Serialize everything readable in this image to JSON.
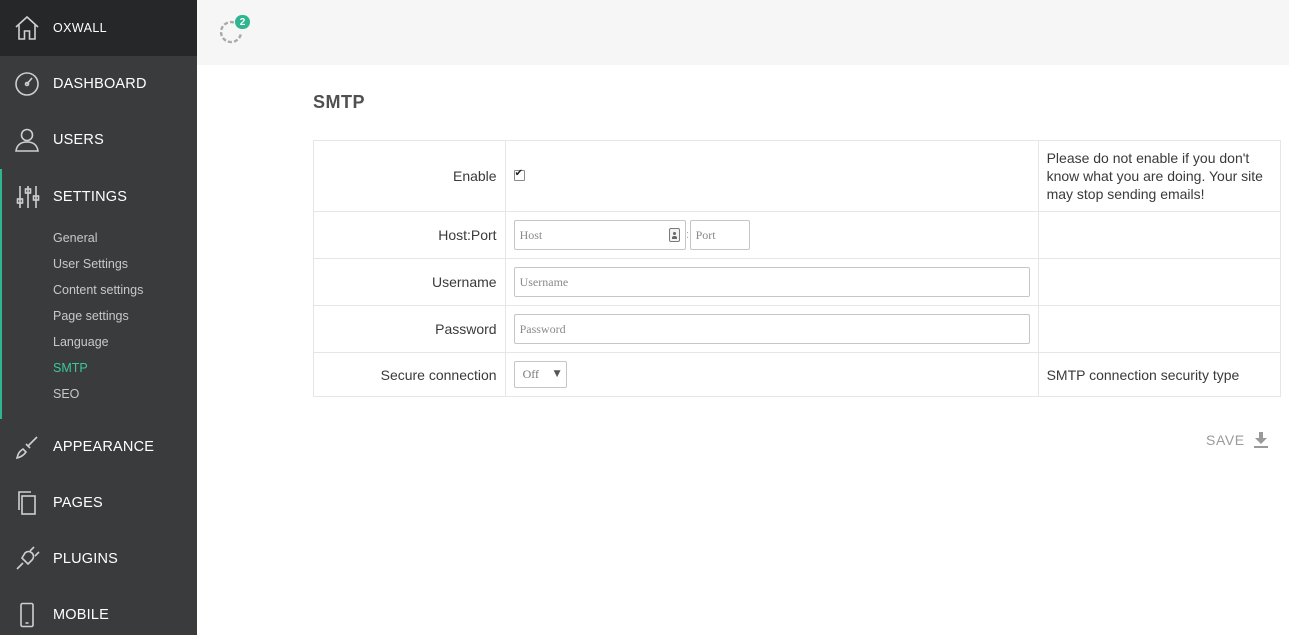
{
  "sidebar": {
    "brand": {
      "label": "OXWALL",
      "icon": "home-icon"
    },
    "items": [
      {
        "label": "DASHBOARD",
        "icon": "gauge-icon"
      },
      {
        "label": "USERS",
        "icon": "user-icon"
      },
      {
        "label": "SETTINGS",
        "icon": "sliders-icon"
      },
      {
        "label": "APPEARANCE",
        "icon": "brush-icon"
      },
      {
        "label": "PAGES",
        "icon": "pages-icon"
      },
      {
        "label": "PLUGINS",
        "icon": "plug-icon"
      },
      {
        "label": "MOBILE",
        "icon": "mobile-icon"
      }
    ],
    "settings_sub": [
      "General",
      "User Settings",
      "Content settings",
      "Page settings",
      "Language",
      "SMTP",
      "SEO"
    ],
    "active_sub": "SMTP"
  },
  "topbar": {
    "sync_badge": "2",
    "icon": "sync-icon"
  },
  "main": {
    "title": "SMTP",
    "rows": {
      "enable": {
        "label": "Enable",
        "checked": true,
        "desc": "Please do not enable if you don't know what you are doing. Your site may stop sending emails!"
      },
      "host_port": {
        "label": "Host:Port",
        "host_placeholder": "Host",
        "colon": ":",
        "port_placeholder": "Port"
      },
      "username": {
        "label": "Username",
        "placeholder": "Username"
      },
      "password": {
        "label": "Password",
        "placeholder": "Password"
      },
      "secure": {
        "label": "Secure connection",
        "value": "Off",
        "desc": "SMTP connection security type"
      }
    },
    "save_label": "SAVE"
  },
  "colors": {
    "accent": "#2fb58f",
    "sidebar_bg": "#3a3b3d",
    "brand_bg": "#262729"
  }
}
